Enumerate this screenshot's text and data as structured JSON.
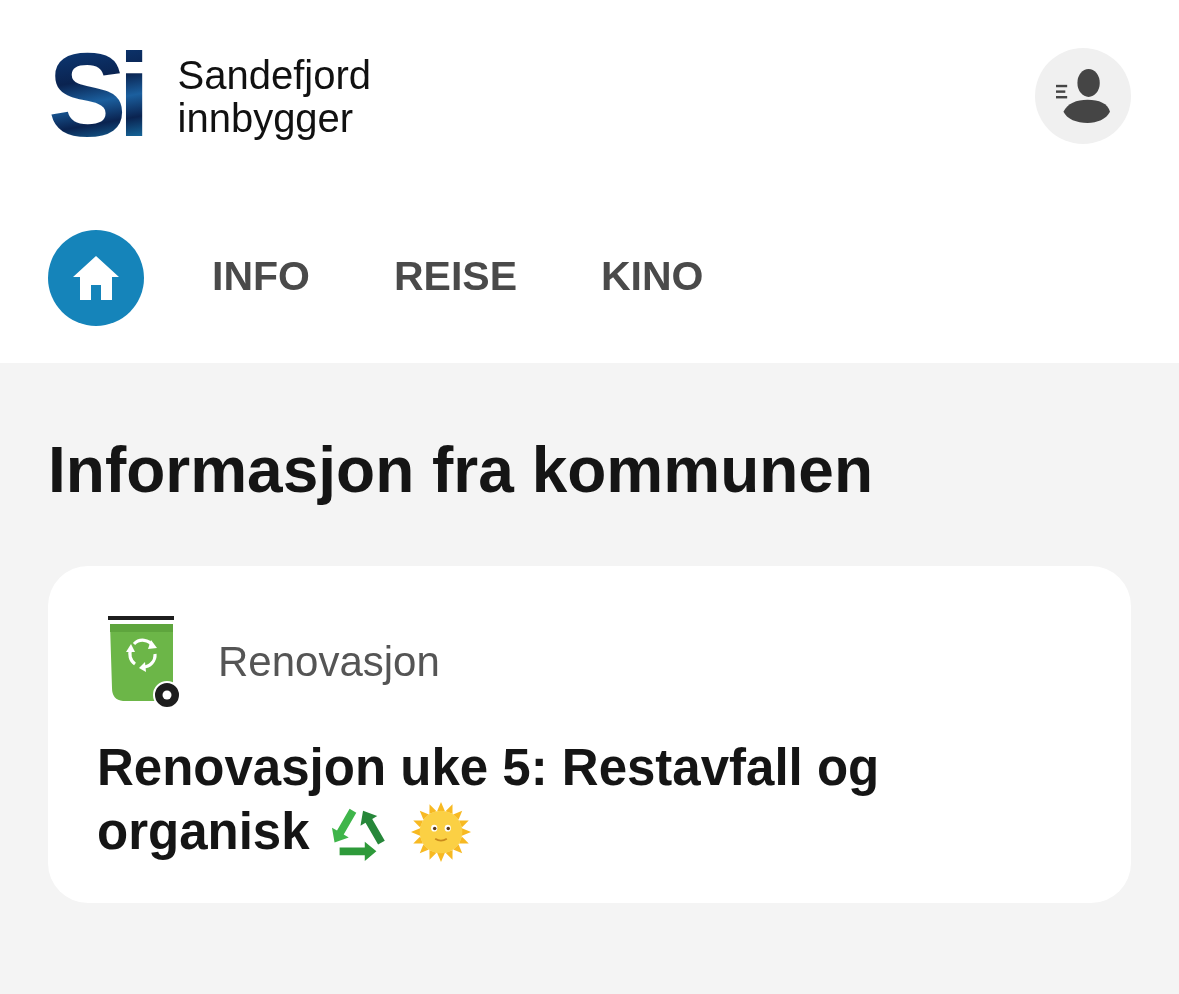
{
  "header": {
    "logo": {
      "mark": "Si",
      "name_lines": [
        "Sandefjord",
        "innbygger"
      ]
    }
  },
  "tabs": [
    {
      "kind": "home",
      "selected": true
    },
    {
      "kind": "text",
      "label": "INFO",
      "selected": false
    },
    {
      "kind": "text",
      "label": "REISE",
      "selected": false
    },
    {
      "kind": "text",
      "label": "KINO",
      "selected": false
    }
  ],
  "main": {
    "heading": "Informasjon fra kommunen",
    "cards": [
      {
        "category": "Renovasjon",
        "title_lines": [
          "Renovasjon uke 5: Restavfall og",
          "organisk"
        ]
      }
    ]
  }
}
